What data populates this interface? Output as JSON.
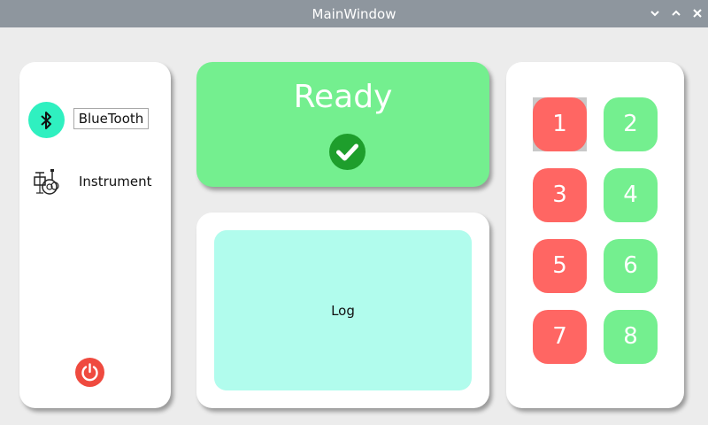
{
  "window": {
    "title": "MainWindow",
    "controls": [
      "chevron-down-icon",
      "chevron-up-icon",
      "close-icon"
    ]
  },
  "sidebar": {
    "bluetooth_label": "BlueTooth",
    "instrument_label": "Instrument"
  },
  "status": {
    "text": "Ready",
    "icon": "check-circle-icon"
  },
  "log": {
    "label": "Log"
  },
  "pads": {
    "labels": [
      "1",
      "2",
      "3",
      "4",
      "5",
      "6",
      "7",
      "8"
    ],
    "states": [
      "red",
      "green",
      "red",
      "green",
      "red",
      "green",
      "red",
      "green"
    ],
    "selected": "1"
  },
  "colors": {
    "titlebar": "#8e969e",
    "background": "#ececec",
    "green": "#74ef8f",
    "red": "#ff6663",
    "bluetooth_teal": "#2ff0c0",
    "log_bg": "#b1fced",
    "power_red": "#ef4a3f"
  }
}
